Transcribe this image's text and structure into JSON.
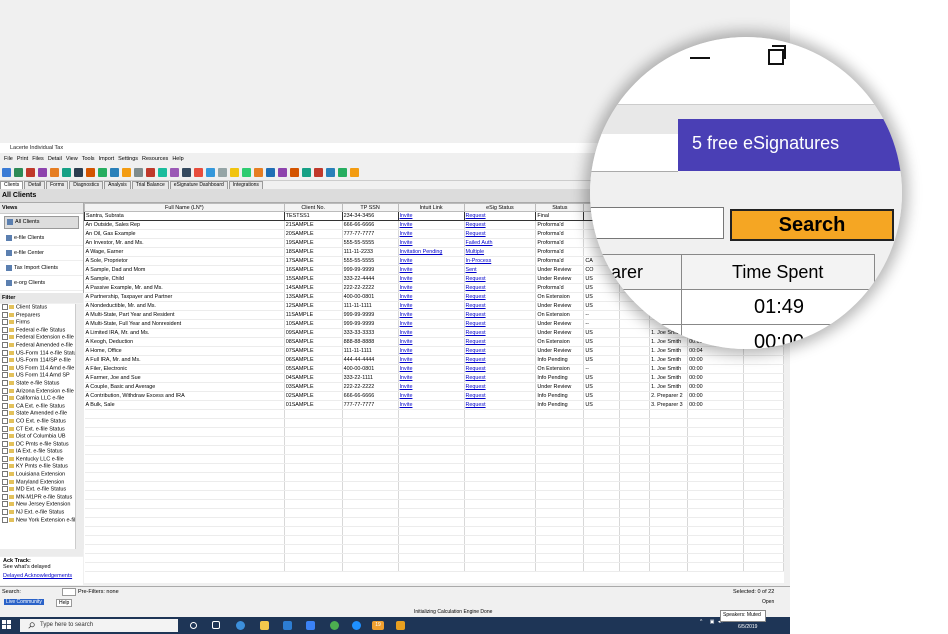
{
  "window": {
    "title": "Lacerte Individual Tax"
  },
  "menu": [
    "File",
    "Print",
    "Files",
    "Detail",
    "View",
    "Tools",
    "Import",
    "Settings",
    "Resources",
    "Help"
  ],
  "tabs": [
    "Clients",
    "Detail",
    "Forms",
    "Diagnostics",
    "Analysis",
    "Trial Balance",
    "eSignature Dashboard",
    "Integrations"
  ],
  "section_title": "All Clients",
  "views": {
    "header": "Views",
    "items": [
      "All Clients",
      "e-file Clients",
      "e-file Center",
      "Tax Import Clients",
      "e-org Clients"
    ]
  },
  "filters": {
    "header": "Filter",
    "items": [
      "Client Status",
      "Preparers",
      "Firms",
      "Federal e-file Status",
      "Federal Extension e-file",
      "Federal Amended e-file",
      "US-Form 114 e-file Status",
      "US-Form 114/SP e-file",
      "US Form 114 Amd e-file",
      "US Form 114 Amd SP",
      "State e-file Status",
      "Arizona Extension e-file",
      "California LLC e-file",
      "CA Ext. e-file Status",
      "State Amended e-file",
      "CO Ext. e-file Status",
      "CT Ext. e-file Status",
      "Dist of Columbia UB",
      "DC Pmts e-file Status",
      "IA Ext. e-file Status",
      "Kentucky LLC e-file",
      "KY Pmts e-file Status",
      "Louisiana Extension",
      "Maryland Extension",
      "MD Ext. e-file Status",
      "MN-M1PR e-file Status",
      "New Jersey Extension",
      "NJ Ext. e-file Status",
      "New York Extension e-file"
    ]
  },
  "ack_track": {
    "title": "Ack Track:",
    "subtitle": "See what's delayed",
    "link": "Delayed Acknowledgements"
  },
  "grid": {
    "columns": [
      "Full Name (LN*)",
      "Client No.",
      "TP SSN",
      "Intuit Link",
      "eSig Status",
      "Status",
      "",
      "",
      "",
      "",
      ""
    ],
    "rows": [
      [
        "Santra, Subrata",
        "TESTSS1",
        "234-34-3456",
        "Invite",
        "Request",
        "Final",
        "",
        "",
        "",
        "",
        ""
      ],
      [
        "An Outside, Sales Rep",
        "21SAMPLE",
        "666-66-6666",
        "Invite",
        "Request",
        "Proforma'd",
        "",
        "",
        "",
        "",
        ""
      ],
      [
        "An Oil, Gas Example",
        "20SAMPLE",
        "777-77-7777",
        "Invite",
        "Request",
        "Proforma'd",
        "",
        "",
        "",
        "",
        ""
      ],
      [
        "An Investor, Mr. and Ms.",
        "19SAMPLE",
        "555-55-5555",
        "Invite",
        "Failed Auth",
        "Proforma'd",
        "",
        "",
        "",
        "",
        ""
      ],
      [
        "A Wage, Earner",
        "18SAMPLE",
        "111-11-2233",
        "Invitation Pending",
        "Multiple",
        "Proforma'd",
        "",
        "",
        "",
        "",
        ""
      ],
      [
        "A Sole, Proprietor",
        "17SAMPLE",
        "555-55-5555",
        "Invite",
        "In-Process",
        "Proforma'd",
        "CA",
        "",
        "",
        "",
        ""
      ],
      [
        "A Sample, Dad and Mom",
        "16SAMPLE",
        "999-99-9999",
        "Invite",
        "Sent",
        "Under Review",
        "CO",
        "",
        "",
        "",
        ""
      ],
      [
        "A Sample, Child",
        "15SAMPLE",
        "333-22-4444",
        "Invite",
        "Request",
        "Under Review",
        "US",
        "",
        "",
        "",
        ""
      ],
      [
        "A Passive Example, Mr. and Ms.",
        "14SAMPLE",
        "222-22-2222",
        "Invite",
        "Request",
        "Proforma'd",
        "US",
        "",
        "",
        "",
        ""
      ],
      [
        "A Partnership, Taxpayer and Partner",
        "13SAMPLE",
        "400-00-0801",
        "Invite",
        "Request",
        "On Extension",
        "US",
        "",
        "",
        "",
        ""
      ],
      [
        "A Nondeductible, Mr. and Ms.",
        "12SAMPLE",
        "111-11-1111",
        "Invite",
        "Request",
        "Under Review",
        "US",
        "",
        "",
        "",
        ""
      ],
      [
        "A Multi-State, Part Year and Resident",
        "11SAMPLE",
        "999-99-9999",
        "Invite",
        "Request",
        "On Extension",
        "--",
        "",
        "",
        "",
        ""
      ],
      [
        "A Multi-State, Full Year and Nonresident",
        "10SAMPLE",
        "999-99-9999",
        "Invite",
        "Request",
        "Under Review",
        "--",
        "",
        "",
        "",
        ""
      ],
      [
        "A Limited IRA, Mr. and Ms.",
        "09SAMPLE",
        "333-33-3333",
        "Invite",
        "Request",
        "Under Review",
        "US",
        "",
        "1. Joe Smith",
        "00:00",
        ""
      ],
      [
        "A Keogh, Deduction",
        "08SAMPLE",
        "888-88-8888",
        "Invite",
        "Request",
        "On Extension",
        "US",
        "",
        "1. Joe Smith",
        "00:00",
        ""
      ],
      [
        "A Home, Office",
        "07SAMPLE",
        "111-11-1111",
        "Invite",
        "Request",
        "Under Review",
        "US",
        "",
        "1. Joe Smith",
        "00:04",
        ""
      ],
      [
        "A Full IRA, Mr. and Ms.",
        "06SAMPLE",
        "444-44-4444",
        "Invite",
        "Request",
        "Info Pending",
        "US",
        "",
        "1. Joe Smith",
        "00:00",
        ""
      ],
      [
        "A Filer, Electronic",
        "05SAMPLE",
        "400-00-0801",
        "Invite",
        "Request",
        "On Extension",
        "--",
        "",
        "1. Joe Smith",
        "00:00",
        ""
      ],
      [
        "A Farmer, Joe and Sue",
        "04SAMPLE",
        "333-22-1111",
        "Invite",
        "Request",
        "Info Pending",
        "US",
        "",
        "1. Joe Smith",
        "00:00",
        ""
      ],
      [
        "A Couple, Basic and Average",
        "03SAMPLE",
        "222-22-2222",
        "Invite",
        "Request",
        "Under Review",
        "US",
        "",
        "1. Joe Smith",
        "00:00",
        ""
      ],
      [
        "A Contribution, Withdraw Excess and IRA",
        "02SAMPLE",
        "666-66-6666",
        "Invite",
        "Request",
        "Info Pending",
        "US",
        "",
        "2. Preparer 2",
        "00:00",
        ""
      ],
      [
        "A Bulk, Sale",
        "01SAMPLE",
        "777-77-7777",
        "Invite",
        "Request",
        "Info Pending",
        "US",
        "",
        "3. Preparer 3",
        "00:00",
        ""
      ]
    ]
  },
  "statusbar": {
    "search_label": "Search:",
    "prefilters": "Pre-Filters: none",
    "selected": "Selected: 0 of 22",
    "open": "Open",
    "live_community": "Live Community",
    "help": "Help",
    "engine": "Initializing Calculation Engine Done",
    "speakers": "Speakers: Muted"
  },
  "taskbar": {
    "search_placeholder": "Type here to search",
    "badge": "19",
    "time": "2:28 PM",
    "date": "6/5/2019"
  },
  "magnifier": {
    "esig_button": "5 free eSignatures",
    "search_button": "Search",
    "col_preparer": "arer",
    "col_time": "Time Spent",
    "cell_preparer": "ith",
    "time_1": "01:49",
    "time_2": "00:00"
  },
  "colors": {
    "esig_bg": "#4a3fb5",
    "search_bg": "#f5a623",
    "link": "#0000cc",
    "taskbar": "#1e3556"
  }
}
